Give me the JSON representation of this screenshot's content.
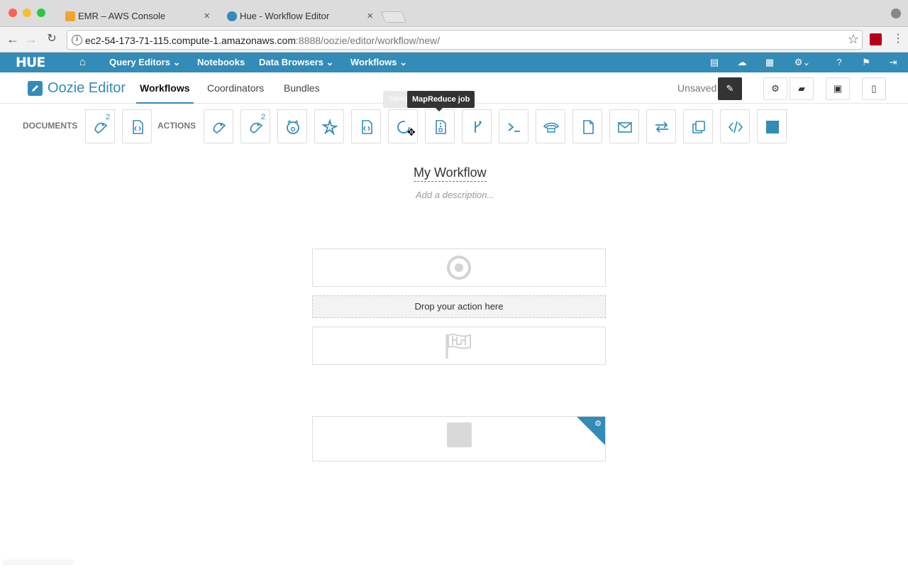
{
  "browser": {
    "tabs": [
      {
        "title": "EMR – AWS Console"
      },
      {
        "title": "Hue - Workflow Editor"
      }
    ],
    "url_host": "ec2-54-173-71-115.compute-1.amazonaws.com",
    "url_path": ":8888/oozie/editor/workflow/new/"
  },
  "hue_nav": {
    "logo": "HUE",
    "items": [
      {
        "label": "Query Editors ⌄"
      },
      {
        "label": "Notebooks"
      },
      {
        "label": "Data Browsers ⌄"
      },
      {
        "label": "Workflows ⌄"
      }
    ]
  },
  "editor": {
    "app_title": "Oozie Editor",
    "tabs": [
      "Workflows",
      "Coordinators",
      "Bundles"
    ],
    "status": "Unsaved"
  },
  "palette": {
    "documents_label": "DOCUMENTS",
    "actions_label": "ACTIONS",
    "doc_superscript": "2",
    "action_superscript": "2",
    "tooltip": "MapReduce job",
    "tooltip_behind": "Sqoop"
  },
  "workflow": {
    "name": "My Workflow",
    "description_placeholder": "Add a description...",
    "drop_hint": "Drop your action here"
  },
  "colors": {
    "hue_blue": "#338bb8"
  }
}
